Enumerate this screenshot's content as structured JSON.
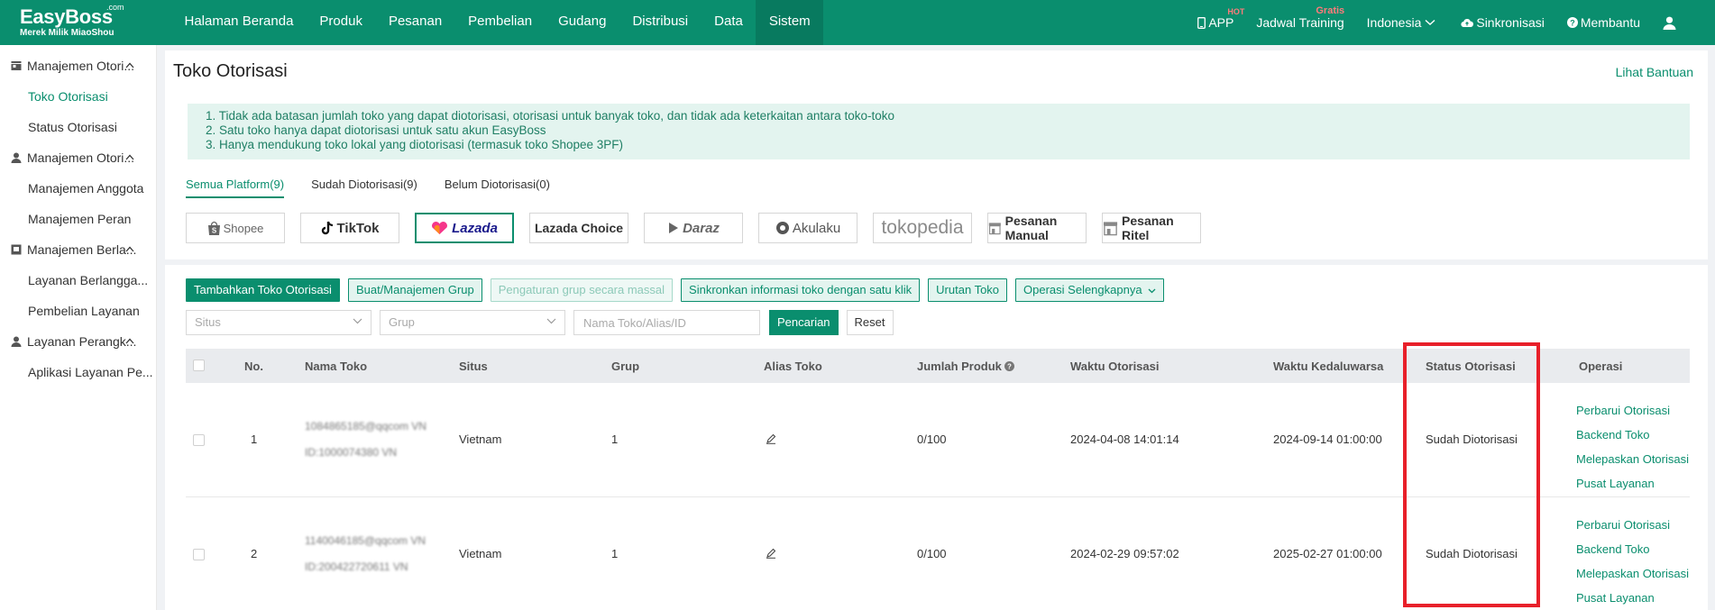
{
  "brand": {
    "name": "EasyBoss",
    "com": ".com",
    "tagline": "Merek Milik MiaoShou"
  },
  "nav": [
    "Halaman Beranda",
    "Produk",
    "Pesanan",
    "Pembelian",
    "Gudang",
    "Distribusi",
    "Data",
    "Sistem"
  ],
  "nav_active": "Sistem",
  "nav_right": {
    "app": "APP",
    "app_badge": "HOT",
    "training": "Jadwal Training",
    "training_badge": "Gratis",
    "language": "Indonesia",
    "sync": "Sinkronisasi",
    "help": "Membantu"
  },
  "sidebar": {
    "groups": [
      {
        "label": "Manajemen Otori...",
        "items": [
          "Toko Otorisasi",
          "Status Otorisasi"
        ]
      },
      {
        "label": "Manajemen Otori...",
        "items": [
          "Manajemen Anggota",
          "Manajemen Peran"
        ]
      },
      {
        "label": "Manajemen Berla...",
        "items": [
          "Layanan Berlangga...",
          "Pembelian Layanan"
        ]
      },
      {
        "label": "Layanan Perangk...",
        "items": [
          "Aplikasi Layanan Pe..."
        ]
      }
    ],
    "active_item": "Toko Otorisasi"
  },
  "page": {
    "title": "Toko Otorisasi",
    "help_link": "Lihat Bantuan"
  },
  "notice": [
    "1. Tidak ada batasan jumlah toko yang dapat diotorisasi, otorisasi untuk banyak toko, dan tidak ada keterkaitan antara toko-toko",
    "2. Satu toko hanya dapat diotorisasi untuk satu akun EasyBoss",
    "3. Hanya mendukung toko lokal yang diotorisasi (termasuk toko Shopee 3PF)"
  ],
  "tabs": [
    "Semua Platform(9)",
    "Sudah Diotorisasi(9)",
    "Belum Diotorisasi(0)"
  ],
  "platforms": [
    "Shopee",
    "TikTok",
    "Lazada",
    "Lazada Choice",
    "Daraz",
    "Akulaku",
    "tokopedia",
    "Pesanan Manual",
    "Pesanan Ritel"
  ],
  "platform_selected": "Lazada",
  "toolbar": {
    "add": "Tambahkan Toko Otorisasi",
    "group": "Buat/Manajemen Grup",
    "bulk": "Pengaturan grup secara massal",
    "sync": "Sinkronkan informasi toko dengan satu klik",
    "order": "Urutan Toko",
    "more": "Operasi Selengkapnya"
  },
  "filters": {
    "site": "Situs",
    "group": "Grup",
    "search_placeholder": "Nama Toko/Alias/ID",
    "search": "Pencarian",
    "reset": "Reset"
  },
  "table": {
    "columns": [
      "No.",
      "Nama Toko",
      "Situs",
      "Grup",
      "Alias Toko",
      "Jumlah Produk",
      "Waktu Otorisasi",
      "Waktu Kedaluwarsa",
      "Status Otorisasi",
      "Operasi"
    ],
    "rows": [
      {
        "no": "1",
        "name_line1": "1084865185@qqcom VN",
        "name_line2": "ID:1000074380 VN",
        "site": "Vietnam",
        "group": "1",
        "products": "0/100",
        "auth_time": "2024-04-08 14:01:14",
        "expire_time": "2024-09-14 01:00:00",
        "status": "Sudah Diotorisasi"
      },
      {
        "no": "2",
        "name_line1": "1140046185@qqcom VN",
        "name_line2": "ID:200422720611 VN",
        "site": "Vietnam",
        "group": "1",
        "products": "0/100",
        "auth_time": "2024-02-29 09:57:02",
        "expire_time": "2025-02-27 01:00:00",
        "status": "Sudah Diotorisasi"
      }
    ],
    "operations": [
      "Perbarui Otorisasi",
      "Backend Toko",
      "Melepaskan Otorisasi",
      "Pusat Layanan"
    ]
  },
  "colors": {
    "primary": "#0a8e6e",
    "highlight_box": "#e8202a"
  }
}
